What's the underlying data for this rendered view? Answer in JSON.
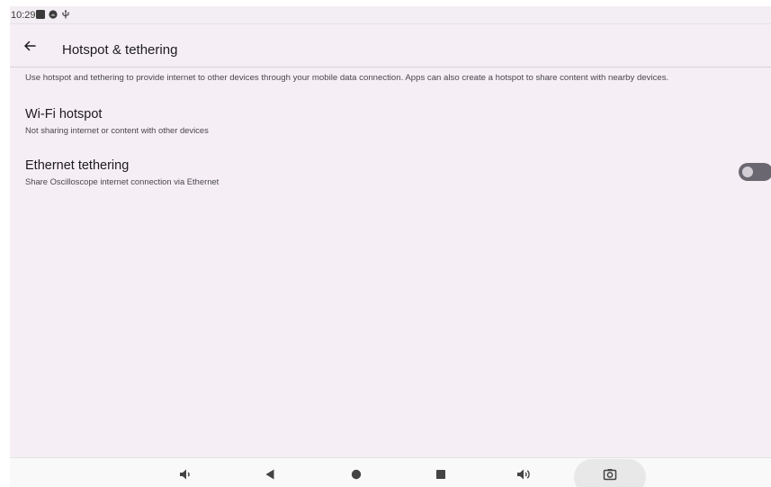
{
  "status_bar": {
    "time": "10:29",
    "icons": [
      "notification-square-icon",
      "android-notification-icon",
      "usb-icon"
    ]
  },
  "app_bar": {
    "back_icon": "arrow-back-icon",
    "title": "Hotspot & tethering"
  },
  "description": "Use hotspot and tethering to provide internet to other devices through your mobile data connection. Apps can also create a hotspot to share content with nearby devices.",
  "preferences": [
    {
      "title": "Wi-Fi hotspot",
      "summary": "Not sharing internet or content with other devices"
    },
    {
      "title": "Ethernet tethering",
      "summary": "Share Oscilloscope internet connection via Ethernet",
      "switch_on": false
    }
  ],
  "nav_bar": {
    "icons": [
      "volume-down-icon",
      "back-triangle-icon",
      "home-circle-icon",
      "recents-square-icon",
      "volume-up-icon",
      "screenshot-camera-icon"
    ]
  },
  "colors": {
    "background": "#f5eff5",
    "switch_track_off": "#6b6770",
    "switch_thumb_off": "#d3ced6"
  }
}
